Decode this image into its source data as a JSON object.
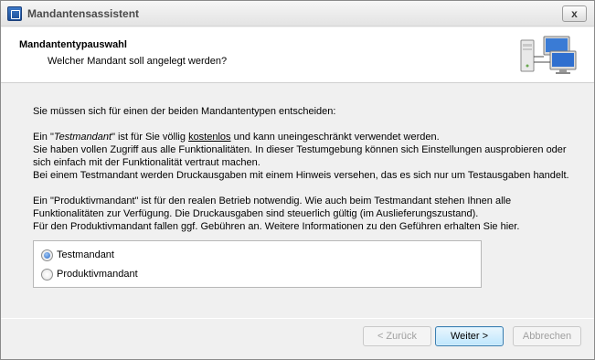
{
  "window": {
    "title": "Mandantensassistent",
    "close_label": "x"
  },
  "header": {
    "title": "Mandantentypauswahl",
    "subtitle": "Welcher Mandant soll angelegt werden?"
  },
  "content": {
    "intro": "Sie müssen sich für einen der beiden Mandantentypen entscheiden:",
    "test": {
      "p1_pre": "Ein \"",
      "p1_italic": "Testmandant",
      "p1_mid": "\" ist für Sie völlig ",
      "p1_underline": "kostenlos",
      "p1_post": " und kann uneingeschränkt verwendet werden.",
      "line2": "Sie haben vollen Zugriff aus alle Funktionalitäten. In dieser Testumgebung können sich Einstellungen ausprobieren oder sich einfach mit der Funktionalität vertraut machen.",
      "line3": "Bei einem Testmandant werden Druckausgaben mit einem Hinweis versehen, das es sich nur um Testausgaben handelt."
    },
    "prod": {
      "line1": "Ein \"Produktivmandant\" ist für den realen Betrieb notwendig. Wie auch beim Testmandant stehen Ihnen alle Funktionalitäten zur Verfügung. Die Druckausgaben sind steuerlich gültig (im Auslieferungszustand).",
      "line2": "Für den Produktivmandant fallen ggf. Gebühren an. Weitere Informationen zu den Geführen erhalten Sie hier."
    }
  },
  "options": {
    "selected": "Testmandant",
    "items": [
      "Testmandant",
      "Produktivmandant"
    ]
  },
  "buttons": {
    "back": "< Zurück",
    "next": "Weiter >",
    "cancel": "Abbrechen"
  }
}
